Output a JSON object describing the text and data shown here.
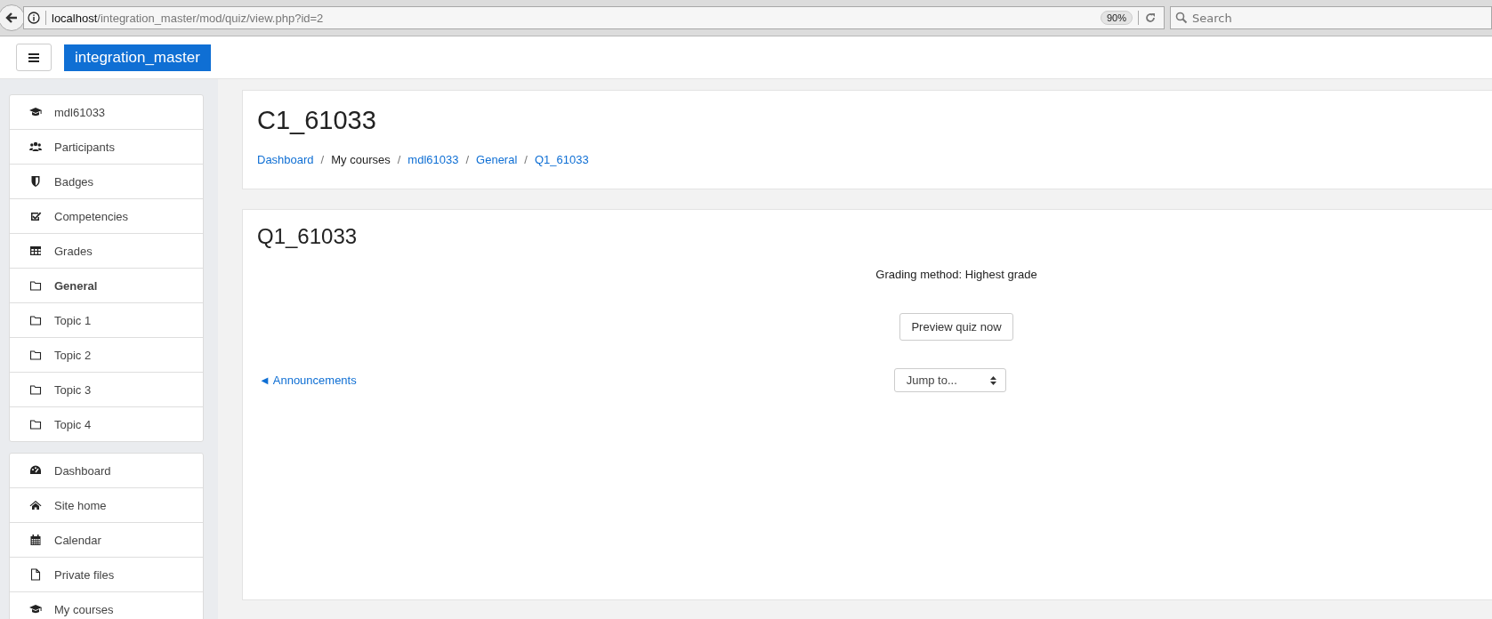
{
  "browser": {
    "url_host": "localhost",
    "url_path": "/integration_master/mod/quiz/view.php?id=2",
    "zoom": "90%",
    "search": {
      "placeholder": "Search"
    }
  },
  "navbar": {
    "brand": "integration_master"
  },
  "sidebar": {
    "groups": [
      {
        "items": [
          {
            "kind": "cap",
            "label": "mdl61033",
            "active": false
          },
          {
            "kind": "people",
            "label": "Participants",
            "active": false
          },
          {
            "kind": "shield",
            "label": "Badges",
            "active": false
          },
          {
            "kind": "check",
            "label": "Competencies",
            "active": false
          },
          {
            "kind": "table",
            "label": "Grades",
            "active": false
          },
          {
            "kind": "folder",
            "label": "General",
            "active": true
          },
          {
            "kind": "folder",
            "label": "Topic 1",
            "active": false
          },
          {
            "kind": "folder",
            "label": "Topic 2",
            "active": false
          },
          {
            "kind": "folder",
            "label": "Topic 3",
            "active": false
          },
          {
            "kind": "folder",
            "label": "Topic 4",
            "active": false
          }
        ]
      },
      {
        "items": [
          {
            "kind": "gauge",
            "label": "Dashboard",
            "active": false
          },
          {
            "kind": "home",
            "label": "Site home",
            "active": false
          },
          {
            "kind": "calendar",
            "label": "Calendar",
            "active": false
          },
          {
            "kind": "file",
            "label": "Private files",
            "active": false
          },
          {
            "kind": "cap",
            "label": "My courses",
            "active": false
          }
        ]
      }
    ]
  },
  "header": {
    "title": "C1_61033",
    "separator": "/",
    "breadcrumb": [
      {
        "label": "Dashboard",
        "link": true
      },
      {
        "label": "My courses",
        "link": false
      },
      {
        "label": "mdl61033",
        "link": true
      },
      {
        "label": "General",
        "link": true
      },
      {
        "label": "Q1_61033",
        "link": true
      }
    ]
  },
  "content": {
    "title": "Q1_61033",
    "grading": "Grading method: Highest grade",
    "preview_button": "Preview quiz now",
    "prev_link": "◄ Announcements",
    "jump": {
      "placeholder": "Jump to..."
    }
  }
}
